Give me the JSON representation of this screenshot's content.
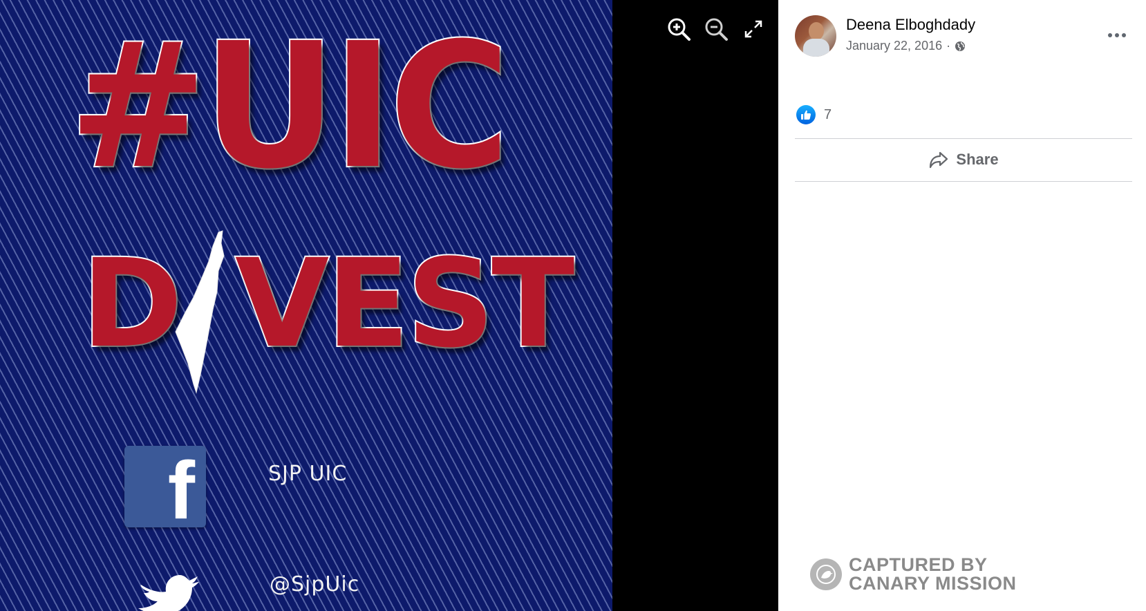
{
  "photo": {
    "headline_hashtag": "#UIC",
    "headline_divest_first": "D",
    "headline_divest_rest": "VEST",
    "facebook_handle": "SJP UIC",
    "twitter_handle": "@SjpUic",
    "facebook_letter": "f",
    "colors": {
      "background": "#0d1a6b",
      "letters": "#b5182a",
      "facebook": "#3b5998"
    }
  },
  "viewer_controls": {
    "zoom_in_icon": "zoom-in-icon",
    "zoom_out_icon": "zoom-out-icon",
    "fullscreen_icon": "fullscreen-icon"
  },
  "post": {
    "author_name": "Deena Elboghdady",
    "date": "January 22, 2016",
    "separator": "·",
    "privacy_icon": "globe-icon",
    "more_icon": "more-options-icon"
  },
  "reactions": {
    "like_count": "7",
    "icon": "like-icon"
  },
  "actions": {
    "share_label": "Share",
    "share_icon": "share-icon"
  },
  "watermark": {
    "line1": "CAPTURED BY",
    "line2": "CANARY MISSION"
  }
}
